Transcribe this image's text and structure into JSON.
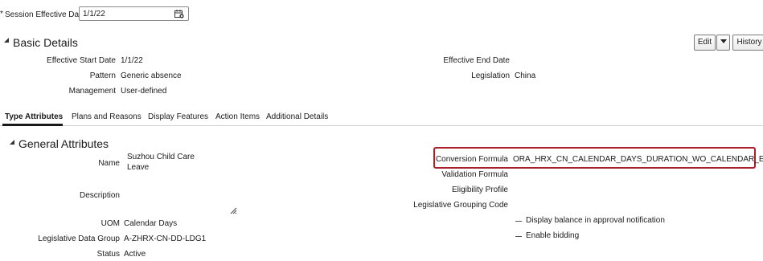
{
  "session": {
    "required_marker": "*",
    "label": "Session Effective Date",
    "value": "1/1/22",
    "icon": "calendar-icon"
  },
  "basic_details": {
    "title": "Basic Details",
    "actions": {
      "edit": "Edit",
      "history": "History"
    },
    "fields": {
      "effective_start_date_label": "Effective Start Date",
      "effective_start_date": "1/1/22",
      "pattern_label": "Pattern",
      "pattern": "Generic absence",
      "management_label": "Management",
      "management": "User-defined",
      "effective_end_date_label": "Effective End Date",
      "effective_end_date": "",
      "legislation_label": "Legislation",
      "legislation": "China"
    }
  },
  "tabs": [
    {
      "label": "Type Attributes",
      "active": true
    },
    {
      "label": "Plans and Reasons",
      "active": false
    },
    {
      "label": "Display Features",
      "active": false
    },
    {
      "label": "Action Items",
      "active": false
    },
    {
      "label": "Additional Details",
      "active": false
    }
  ],
  "general_attributes": {
    "title": "General Attributes",
    "name_label": "Name",
    "name_line1": "Suzhou Child Care",
    "name_line2": "Leave",
    "description_label": "Description",
    "description": "",
    "uom_label": "UOM",
    "uom": "Calendar Days",
    "ldg_label": "Legislative Data Group",
    "ldg": "A-ZHRX-CN-DD-LDG1",
    "status_label": "Status",
    "status": "Active",
    "conversion_formula_label": "Conversion Formula",
    "conversion_formula": "ORA_HRX_CN_CALENDAR_DAYS_DURATION_WO_CALENDAR_EVENTS",
    "validation_formula_label": "Validation Formula",
    "eligibility_profile_label": "Eligibility Profile",
    "legislative_grouping_code_label": "Legislative Grouping Code",
    "display_balance_label": "Display balance in approval notification",
    "enable_bidding_label": "Enable bidding"
  },
  "colors": {
    "highlight_border": "#a8202a"
  }
}
